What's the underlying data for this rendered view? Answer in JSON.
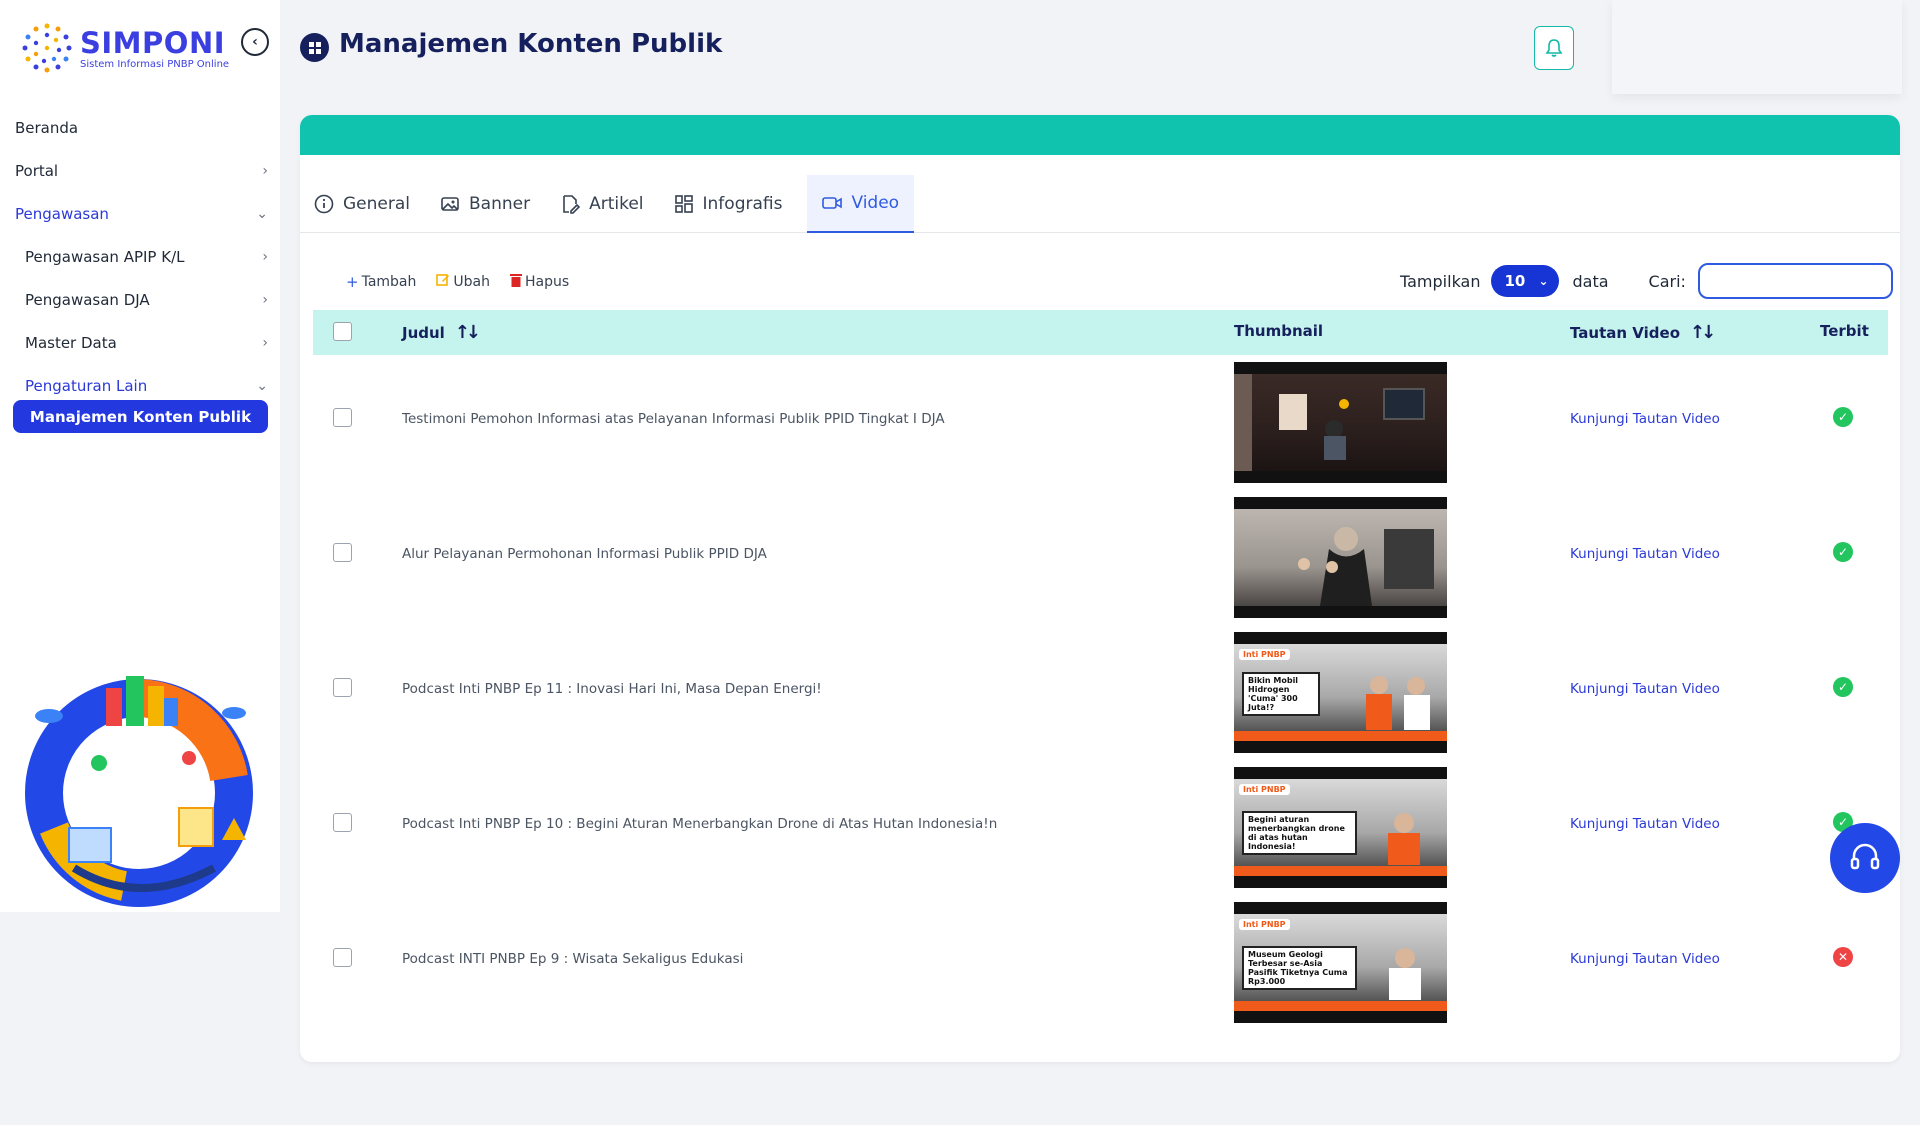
{
  "app": {
    "logo_title": "SIMPONI",
    "logo_subtitle": "Sistem Informasi PNBP Online"
  },
  "sidebar": {
    "items": [
      {
        "label": "Beranda",
        "chevron": false
      },
      {
        "label": "Portal",
        "chevron": "right"
      },
      {
        "label": "Pengawasan",
        "chevron": "down"
      },
      {
        "label": "Pengawasan APIP K/L",
        "chevron": "right"
      },
      {
        "label": "Pengawasan DJA",
        "chevron": "right"
      },
      {
        "label": "Master Data",
        "chevron": "right"
      },
      {
        "label": "Pengaturan Lain",
        "chevron": "down"
      }
    ],
    "active_item": "Manajemen Konten Publik"
  },
  "header": {
    "title": "Manajemen Konten Publik",
    "page_icon": "grid-icon",
    "notification_icon": "bell-icon"
  },
  "tabs": [
    {
      "label": "General",
      "icon": "info-icon"
    },
    {
      "label": "Banner",
      "icon": "image-icon"
    },
    {
      "label": "Artikel",
      "icon": "edit-file-icon"
    },
    {
      "label": "Infografis",
      "icon": "grid-layout-icon"
    },
    {
      "label": "Video",
      "icon": "video-icon",
      "active": true
    }
  ],
  "toolbar": {
    "add": "Tambah",
    "edit": "Ubah",
    "delete": "Hapus"
  },
  "length_control": {
    "label_before": "Tampilkan",
    "value": "10",
    "label_after": "data"
  },
  "search": {
    "label": "Cari:",
    "value": ""
  },
  "table": {
    "columns": [
      "Judul",
      "Thumbnail",
      "Tautan Video",
      "Terbit"
    ],
    "rows": [
      {
        "title": "Testimoni Pemohon Informasi atas Pelayanan Informasi Publik PPID Tingkat I DJA",
        "link": "Kunjungi Tautan Video",
        "published": true
      },
      {
        "title": "Alur Pelayanan Permohonan Informasi Publik PPID DJA",
        "link": "Kunjungi Tautan Video",
        "published": true
      },
      {
        "title": "Podcast Inti PNBP Ep 11 : Inovasi Hari Ini, Masa Depan Energi!",
        "link": "Kunjungi Tautan Video",
        "published": true,
        "thumb_caption": "Bikin Mobil Hidrogen 'Cuma' 300 Juta!?"
      },
      {
        "title": "Podcast Inti PNBP Ep 10 : Begini Aturan Menerbangkan Drone di Atas Hutan Indonesia!n",
        "link": "Kunjungi Tautan Video",
        "published": true,
        "thumb_caption": "Begini aturan menerbangkan drone di atas hutan Indonesia!"
      },
      {
        "title": "Podcast INTI PNBP Ep 9 : Wisata Sekaligus Edukasi",
        "link": "Kunjungi Tautan Video",
        "published": false,
        "thumb_caption": "Museum Geologi Terbesar se-Asia Pasifik Tiketnya Cuma Rp3.000"
      }
    ]
  },
  "thumb_tag": "Inti PNBP",
  "colors": {
    "brand": "#3b3fe0",
    "accent_teal": "#0fc3ae",
    "active_blue": "#2438e0",
    "success": "#22c55e",
    "danger": "#ef4444"
  }
}
